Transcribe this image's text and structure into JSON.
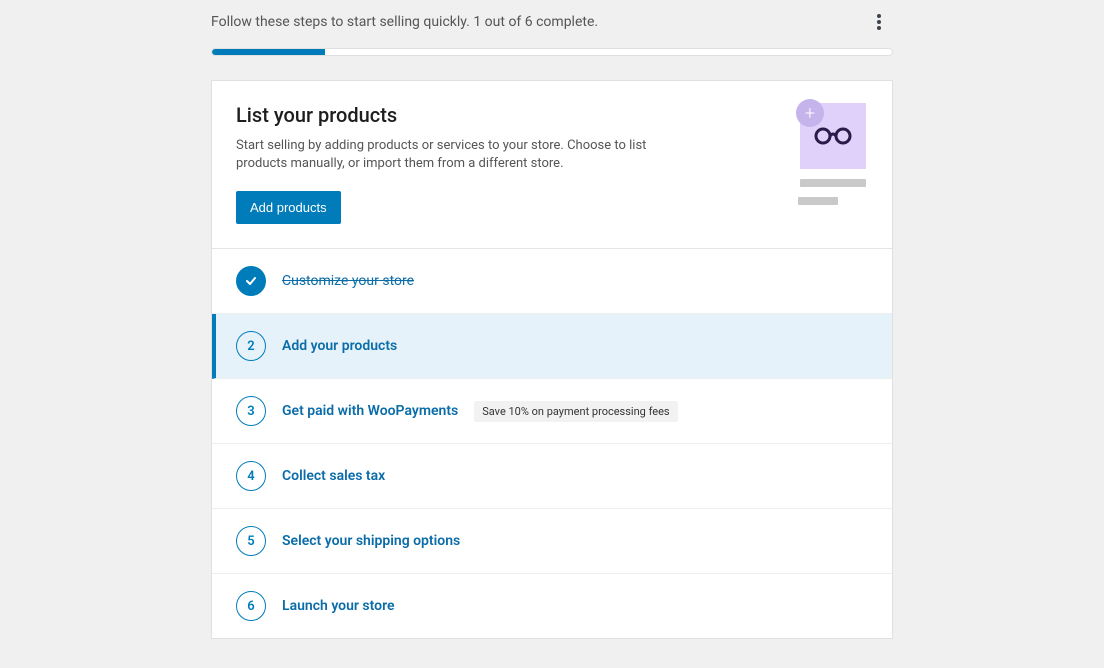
{
  "header": {
    "progress_text": "Follow these steps to start selling quickly. 1 out of 6 complete.",
    "progress_percent": 16.6
  },
  "card": {
    "title": "List your products",
    "description": "Start selling by adding products or services to your store. Choose to list products manually, or import them from a different store.",
    "cta_label": "Add products"
  },
  "tasks": [
    {
      "num": 1,
      "label": "Customize your store",
      "completed": true,
      "active": false,
      "badge": null
    },
    {
      "num": 2,
      "label": "Add your products",
      "completed": false,
      "active": true,
      "badge": null
    },
    {
      "num": 3,
      "label": "Get paid with WooPayments",
      "completed": false,
      "active": false,
      "badge": "Save 10% on payment processing fees"
    },
    {
      "num": 4,
      "label": "Collect sales tax",
      "completed": false,
      "active": false,
      "badge": null
    },
    {
      "num": 5,
      "label": "Select your shipping options",
      "completed": false,
      "active": false,
      "badge": null
    },
    {
      "num": 6,
      "label": "Launch your store",
      "completed": false,
      "active": false,
      "badge": null
    }
  ]
}
